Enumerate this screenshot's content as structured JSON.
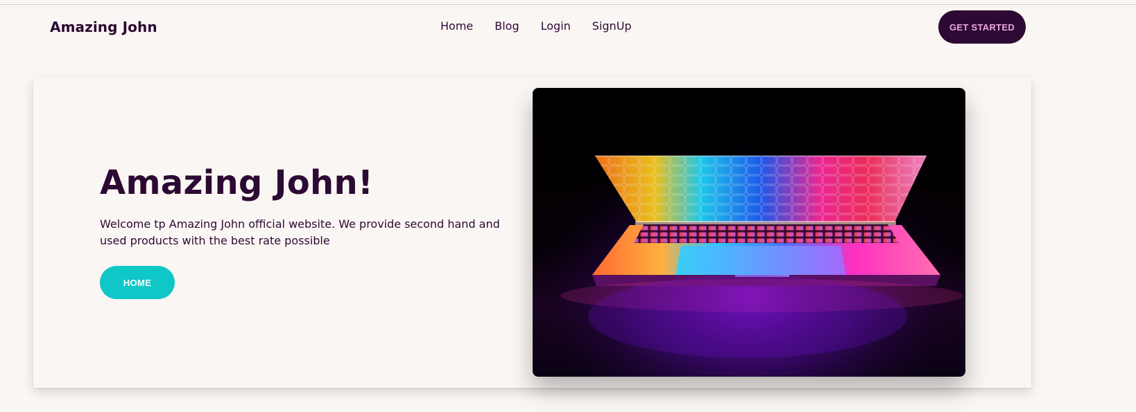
{
  "navbar": {
    "brand": "Amazing John",
    "links": [
      {
        "label": "Home"
      },
      {
        "label": "Blog"
      },
      {
        "label": "Login"
      },
      {
        "label": "SignUp"
      }
    ],
    "cta_label": "GET STARTED"
  },
  "hero": {
    "title": "Amazing John!",
    "description": "Welcome tp Amazing John official website. We provide second hand and used products with the best rate possible",
    "button_label": "HOME"
  },
  "colors": {
    "brand": "#2c0a33",
    "accent": "#10c7c7",
    "cta_text": "#f0a8e0",
    "background": "#faf6f4"
  }
}
